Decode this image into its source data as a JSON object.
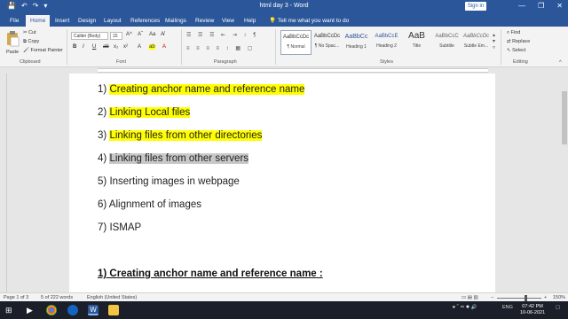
{
  "window": {
    "title": "html day 3  -  Word",
    "signin": "Sign in",
    "minimize": "—",
    "restore": "❐",
    "close": "✕"
  },
  "tabs": [
    "File",
    "Home",
    "Insert",
    "Design",
    "Layout",
    "References",
    "Mailings",
    "Review",
    "View",
    "Help"
  ],
  "tell_me": "Tell me what you want to do",
  "ribbon": {
    "clipboard": {
      "label": "Clipboard",
      "paste": "Paste",
      "cut": "Cut",
      "copy": "Copy",
      "format_painter": "Format Painter"
    },
    "font": {
      "label": "Font",
      "name": "Calibri (Body)",
      "size": "15",
      "bold": "B",
      "italic": "I",
      "underline": "U",
      "strike": "ab",
      "subscript": "x₂",
      "superscript": "x²"
    },
    "paragraph": {
      "label": "Paragraph"
    },
    "styles": {
      "label": "Styles",
      "items": [
        {
          "sample": "AaBbCcDc",
          "name": "¶ Normal"
        },
        {
          "sample": "AaBbCcDc",
          "name": "¶ No Spac..."
        },
        {
          "sample": "AaBbCc",
          "name": "Heading 1"
        },
        {
          "sample": "AaBbCcE",
          "name": "Heading 2"
        },
        {
          "sample": "AaB",
          "name": "Title"
        },
        {
          "sample": "AaBbCcC",
          "name": "Subtitle"
        },
        {
          "sample": "AaBbCcDc",
          "name": "Subtle Em..."
        }
      ]
    },
    "editing": {
      "label": "Editing",
      "find": "Find",
      "replace": "Replace",
      "select": "Select"
    }
  },
  "document": {
    "items": [
      {
        "num": "1)",
        "text": "Creating anchor name and reference name",
        "highlight": "yellow"
      },
      {
        "num": "2)",
        "text": "Linking Local files",
        "highlight": "yellow"
      },
      {
        "num": "3)",
        "text": "Linking files from other directories",
        "highlight": "yellow"
      },
      {
        "num": "4)",
        "text": "Linking files from other servers",
        "highlight": "gray"
      },
      {
        "num": "5)",
        "text": "Inserting images in webpage",
        "highlight": "none"
      },
      {
        "num": "6)",
        "text": "Alignment of images",
        "highlight": "none"
      },
      {
        "num": "7)",
        "text": "ISMAP",
        "highlight": "none"
      }
    ],
    "heading": "1) Creating anchor name and reference name :"
  },
  "status": {
    "page": "Page 1 of 3",
    "words": "5 of 222 words",
    "language": "English (United States)",
    "zoom": "150%"
  },
  "taskbar": {
    "lang": "ENG",
    "time": "07:42 PM",
    "date": "10-06-2021"
  }
}
